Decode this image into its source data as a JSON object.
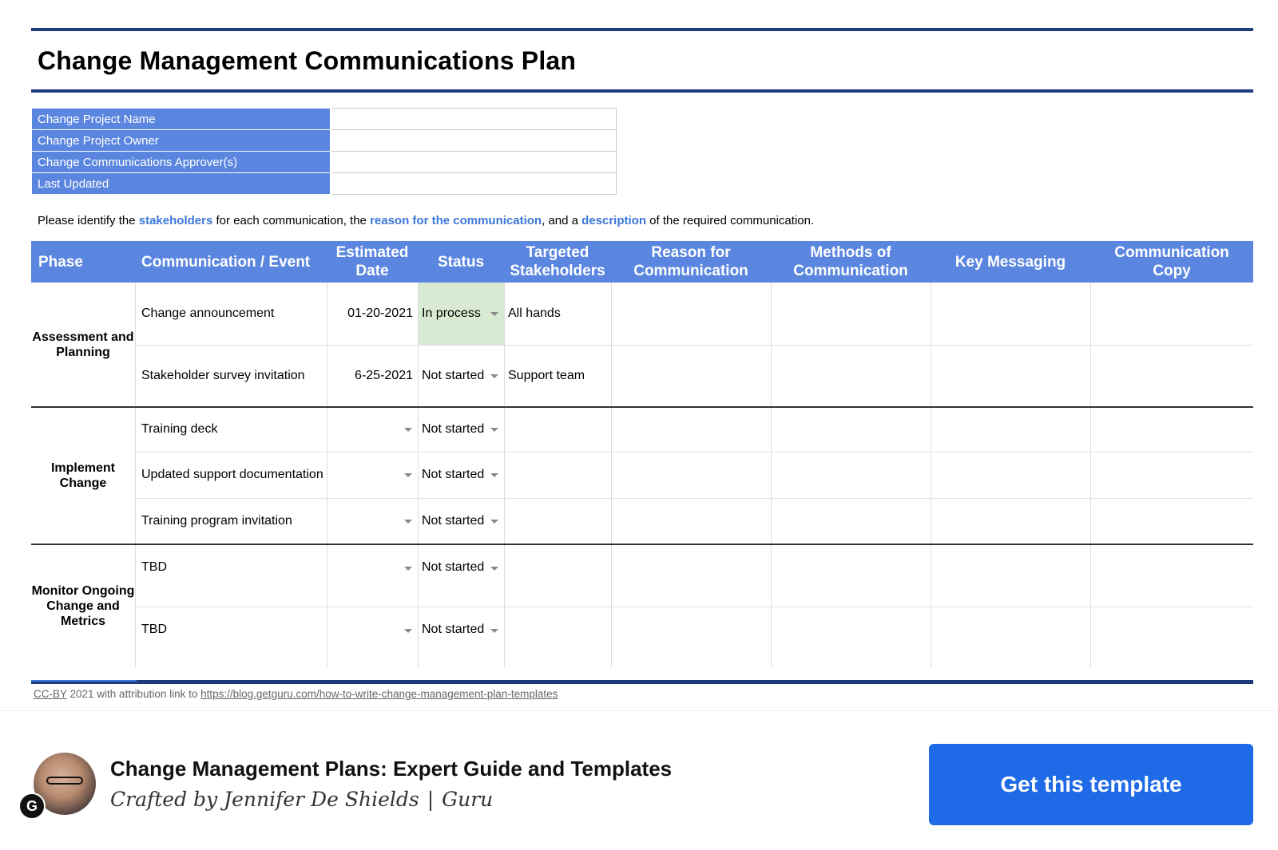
{
  "doc": {
    "title": "Change Management Communications Plan",
    "info_rows": [
      {
        "label": "Change Project Name",
        "value": ""
      },
      {
        "label": "Change Project Owner",
        "value": ""
      },
      {
        "label": "Change Communications Approver(s)",
        "value": ""
      },
      {
        "label": "Last Updated",
        "value": ""
      }
    ],
    "instructions": {
      "p1": "Please identify the ",
      "h1": "stakeholders",
      "p2": " for each communication, the ",
      "h2": "reason for the communication",
      "p3": ", and a ",
      "h3": "description",
      "p4": " of the required communication."
    }
  },
  "table": {
    "headers": [
      "Phase",
      "Communication / Event",
      "Estimated Date",
      "Status",
      "Targeted Stakeholders",
      "Reason for Communication",
      "Methods of Communication",
      "Key Messaging",
      "Communication Copy"
    ],
    "phases": [
      "Assessment and Planning",
      "Implement Change",
      "Monitor Ongoing Change and Metrics"
    ],
    "rows": [
      {
        "event": "Change announcement",
        "date": "01-20-2021",
        "status": "In process",
        "stakeholders": "All hands"
      },
      {
        "event": "Stakeholder survey invitation",
        "date": "6-25-2021",
        "status": "Not started",
        "stakeholders": "Support team"
      },
      {
        "event": "Training deck",
        "date": "",
        "status": "Not started",
        "stakeholders": ""
      },
      {
        "event": "Updated support documentation",
        "date": "",
        "status": "Not started",
        "stakeholders": ""
      },
      {
        "event": "Training program invitation",
        "date": "",
        "status": "Not started",
        "stakeholders": ""
      },
      {
        "event": "TBD",
        "date": "",
        "status": "Not started",
        "stakeholders": ""
      },
      {
        "event": "TBD",
        "date": "",
        "status": "Not started",
        "stakeholders": ""
      }
    ]
  },
  "license": {
    "cc": "CC-BY",
    "text": " 2021 with attribution link to ",
    "link": "https://blog.getguru.com/how-to-write-change-management-plan-templates"
  },
  "footer": {
    "title": "Change Management Plans: Expert Guide and Templates",
    "author": "Crafted by Jennifer De Shields",
    "separator": "|",
    "org": "Guru",
    "badge_letter": "G",
    "cta_label": "Get this template"
  },
  "colors": {
    "rule": "#1d3c7a",
    "header_fill": "#5b86e0",
    "highlight_text": "#3b76d8",
    "status_in_process": "#d9ead3",
    "cta": "#1f6ae7"
  }
}
